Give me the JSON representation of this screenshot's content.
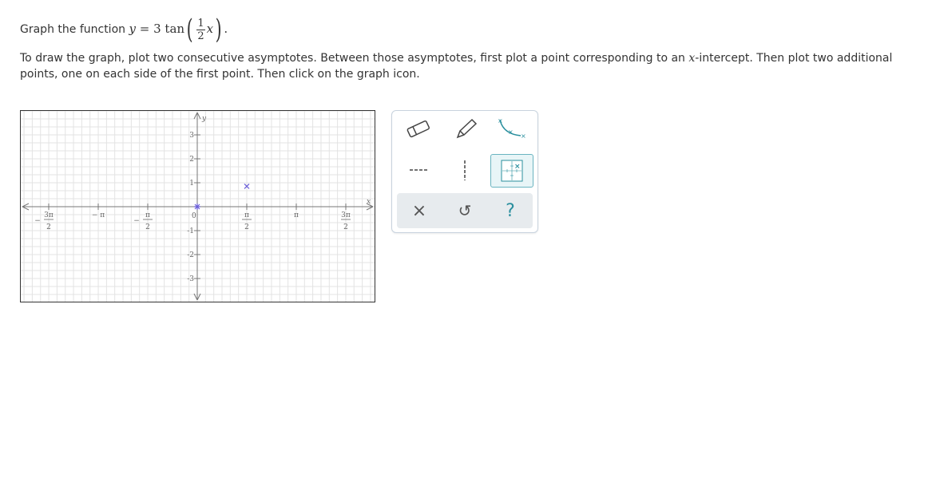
{
  "question": {
    "prompt_prefix": "Graph the function",
    "func_y": "y",
    "func_eq": "=",
    "func_coef": "3",
    "func_name": "tan",
    "frac_num": "1",
    "frac_den": "2",
    "func_var": "x",
    "func_end": ".",
    "instr_part1": "To draw the graph, plot two consecutive asymptotes. Between those asymptotes, first plot a point corresponding to an",
    "instr_var": "x",
    "instr_part2": "-intercept. Then plot two additional points, one on each side of the first point. Then click on the graph icon."
  },
  "graph": {
    "x_axis_label": "x",
    "y_axis_label": "y",
    "y_ticks": [
      "3",
      "2",
      "1",
      "-1",
      "-2",
      "-3"
    ],
    "origin_label": "0",
    "x_ticks": [
      {
        "top": "3π",
        "bottom": "2",
        "sign": "−"
      },
      {
        "top": "− π",
        "bottom": "",
        "sign": ""
      },
      {
        "top": "π",
        "bottom": "2",
        "sign": "−"
      },
      {
        "top": "π",
        "bottom": "2",
        "sign": ""
      },
      {
        "top": "π",
        "bottom": "",
        "sign": ""
      },
      {
        "top": "3π",
        "bottom": "2",
        "sign": ""
      }
    ],
    "plotted_points": [
      {
        "x_label": "0",
        "y": 0,
        "marker": "asterisk",
        "color": "#6b5fd8"
      },
      {
        "x_label": "π/2",
        "y": 0.55,
        "marker": "x",
        "color": "#6b5fd8"
      }
    ]
  },
  "toolbar": {
    "tools": [
      {
        "name": "eraser",
        "icon": "eraser-icon"
      },
      {
        "name": "pencil",
        "icon": "pencil-icon"
      },
      {
        "name": "curve",
        "icon": "curve-icon"
      },
      {
        "name": "horizontal-asymptote",
        "icon": "dashed-horizontal-line-icon"
      },
      {
        "name": "vertical-asymptote",
        "icon": "dashed-vertical-line-icon"
      },
      {
        "name": "graph",
        "icon": "graph-icon",
        "active": true
      }
    ],
    "actions": [
      {
        "name": "clear",
        "label": "×"
      },
      {
        "name": "undo",
        "label": "↺"
      },
      {
        "name": "help",
        "label": "?"
      }
    ],
    "accent_color": "#2a8f9e"
  }
}
